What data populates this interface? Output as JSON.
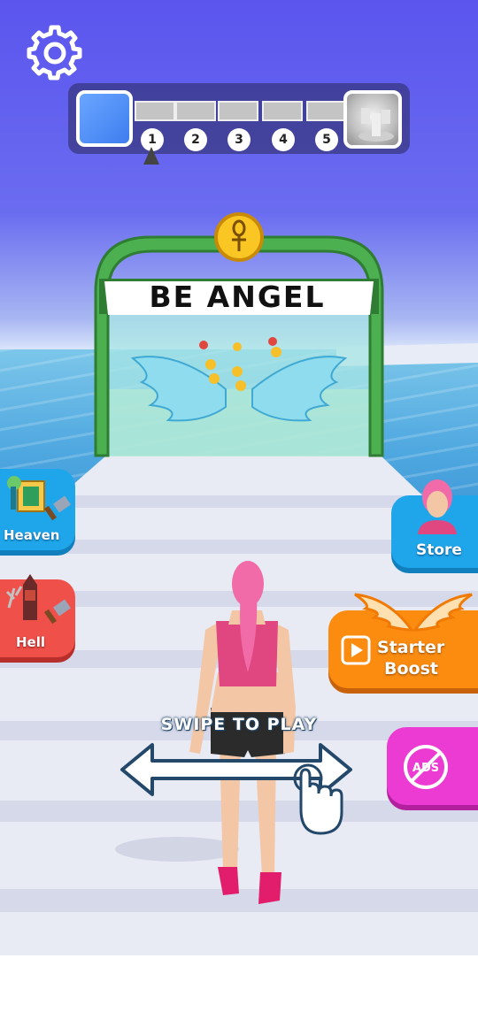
{
  "hud": {
    "levels": [
      "1",
      "2",
      "3",
      "4",
      "5"
    ],
    "current_level": 1
  },
  "gate": {
    "title": "BE ANGEL"
  },
  "side_menu": {
    "heaven_label": "Heaven",
    "hell_label": "Hell",
    "store_label": "Store",
    "boost_label_line1": "Starter",
    "boost_label_line2": "Boost",
    "noads_label": "ADS"
  },
  "tutorial": {
    "swipe_label": "SWIPE TO PLAY"
  },
  "colors": {
    "sky": "#5b55ee",
    "gate_green": "#4caf50",
    "store_blue": "#1fa6ea",
    "hell_red": "#f0504a",
    "boost_orange": "#fb8c10",
    "noads_pink": "#ec3bd2",
    "character_hair": "#f06ba8"
  }
}
